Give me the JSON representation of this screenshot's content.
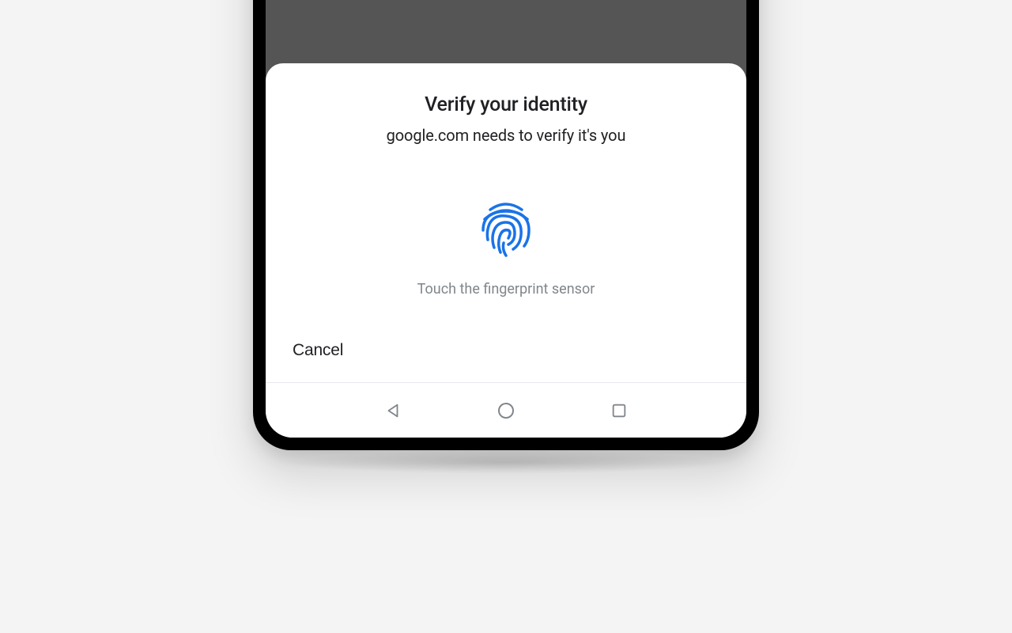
{
  "dialog": {
    "title": "Verify your identity",
    "subtitle": "google.com needs to verify it's you",
    "instruction": "Touch the fingerprint sensor",
    "cancel_label": "Cancel"
  },
  "colors": {
    "accent": "#1a73e8",
    "text_primary": "#202124",
    "text_secondary": "#80868b"
  }
}
